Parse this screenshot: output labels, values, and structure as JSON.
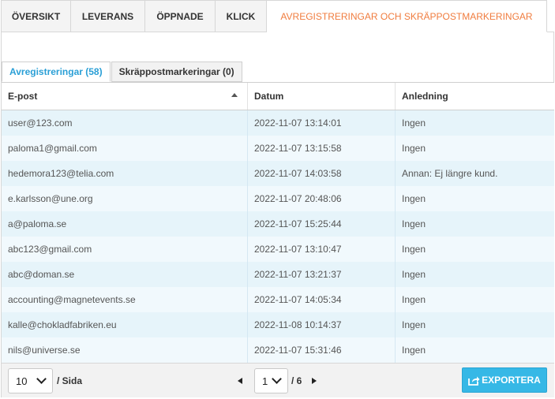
{
  "tabs": [
    {
      "label": "ÖVERSIKT"
    },
    {
      "label": "LEVERANS"
    },
    {
      "label": "ÖPPNADE"
    },
    {
      "label": "KLICK"
    },
    {
      "label": "AVREGISTRERINGAR OCH SKRÄPPOSTMARKERINGAR",
      "active": true
    }
  ],
  "subtabs": [
    {
      "label": "Avregistreringar (58)",
      "active": true
    },
    {
      "label": "Skräppostmarkeringar (0)"
    }
  ],
  "table": {
    "columns": [
      "E-post",
      "Datum",
      "Anledning"
    ],
    "rows": [
      [
        "user@123.com",
        "2022-11-07 13:14:01",
        "Ingen"
      ],
      [
        "paloma1@gmail.com",
        "2022-11-07 13:15:58",
        "Ingen"
      ],
      [
        "hedemora123@telia.com",
        "2022-11-07 14:03:58",
        "Annan: Ej längre kund."
      ],
      [
        "e.karlsson@une.org",
        "2022-11-07 20:48:06",
        "Ingen"
      ],
      [
        "a@paloma.se",
        "2022-11-07 15:25:44",
        "Ingen"
      ],
      [
        "abc123@gmail.com",
        "2022-11-07 13:10:47",
        "Ingen"
      ],
      [
        "abc@doman.se",
        "2022-11-07 13:21:37",
        "Ingen"
      ],
      [
        "accounting@magnetevents.se",
        "2022-11-07 14:05:34",
        "Ingen"
      ],
      [
        "kalle@chokladfabriken.eu",
        "2022-11-08 10:14:37",
        "Ingen"
      ],
      [
        "nils@universe.se",
        "2022-11-07 15:31:46",
        "Ingen"
      ]
    ]
  },
  "footer": {
    "per_page": "10",
    "per_page_label": "/ Sida",
    "page": "1",
    "total_pages": "/ 6",
    "export_label": "EXPORTERA"
  },
  "colors": {
    "accent": "#f07c3e",
    "link": "#2a9fd6",
    "export": "#36b8e6",
    "row_odd": "#e6f4fa",
    "row_even": "#f1f9fd"
  }
}
